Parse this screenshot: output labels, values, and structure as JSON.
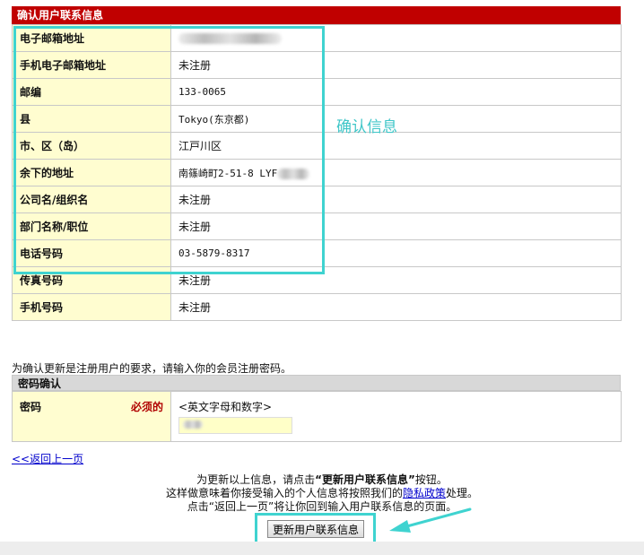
{
  "header": {
    "title": "确认用户联系信息"
  },
  "rows": [
    {
      "label": "电子邮箱地址",
      "value": ""
    },
    {
      "label": "手机电子邮箱地址",
      "value": "未注册"
    },
    {
      "label": "邮编",
      "value": "133-0065"
    },
    {
      "label": "县",
      "value": "Tokyo(东京都)"
    },
    {
      "label": "市、区（岛）",
      "value": "江戸川区"
    },
    {
      "label": "余下的地址",
      "value": "南篠崎町2-51-8 LYF"
    },
    {
      "label": "公司名/组织名",
      "value": "未注册"
    },
    {
      "label": "部门名称/职位",
      "value": "未注册"
    },
    {
      "label": "电话号码",
      "value": "03-5879-8317"
    },
    {
      "label": "传真号码",
      "value": "未注册"
    },
    {
      "label": "手机号码",
      "value": "未注册"
    }
  ],
  "annotation": {
    "text": "确认信息",
    "color": "#3fd3d0"
  },
  "password": {
    "note": "为确认更新是注册用户的要求，请输入你的会员注册密码。",
    "section_title": "密码确认",
    "label": "密码",
    "required": "必须的",
    "hint": "<英文字母和数字>",
    "value": ""
  },
  "back_link": "<<返回上一页",
  "bottom": {
    "line1_prefix": "为更新以上信息，请点击",
    "line1_bold": "“更新用户联系信息”",
    "line1_suffix": "按钮。",
    "line2_prefix": "这样做意味着你接受输入的个人信息将按照我们的",
    "line2_link": "隐私政策",
    "line2_suffix": "处理。",
    "line3": "点击“返回上一页”将让你回到输入用户联系信息的页面。"
  },
  "submit_label": "更新用户联系信息",
  "colors": {
    "header": "#c00000",
    "label_bg": "#fffdd0",
    "annotation": "#3fd3d0"
  }
}
